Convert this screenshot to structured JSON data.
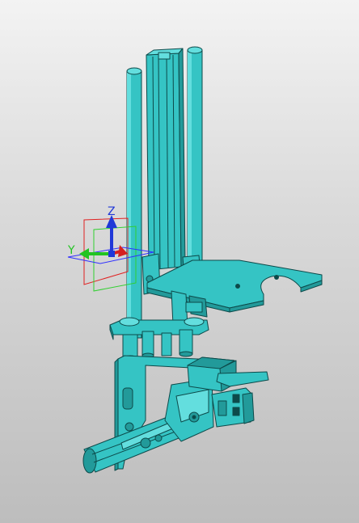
{
  "viewport": {
    "background_top": "#f3f3f3",
    "background_bottom": "#bdbdbd"
  },
  "model": {
    "part_color": "#35c4c4",
    "edge_color": "#0d4a4a",
    "shade_color": "#229a9a",
    "highlight_color": "#63dede"
  },
  "triad": {
    "z_label": "Z",
    "y_label": "Y",
    "x_color": "#d62020",
    "y_color": "#22c422",
    "z_color": "#2038d8",
    "xy_plane_color": "#3030ff",
    "yz_plane_color": "#30d030",
    "xz_plane_color": "#e02020"
  }
}
